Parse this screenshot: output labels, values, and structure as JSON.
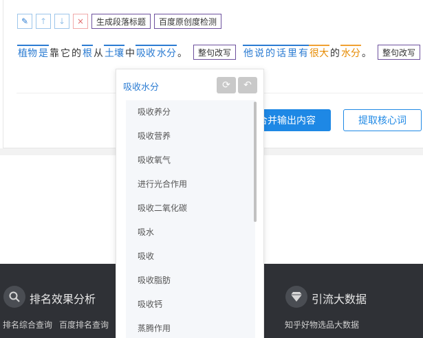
{
  "toolbar": {
    "edit_icon": "✎",
    "up_icon": "↑",
    "down_icon": "↓",
    "close_icon": "×",
    "generate_heading_label": "生成段落标题",
    "originality_check_label": "百度原创度检测"
  },
  "sentence1": {
    "words": [
      "植物",
      "是",
      "靠",
      "它",
      "的",
      "根",
      "从",
      "土壤",
      "中",
      "吸收",
      "水分",
      "。"
    ],
    "rewrite_label": "整句改写"
  },
  "sentence2": {
    "words": [
      "他",
      "说",
      "的",
      "话",
      "里",
      "有",
      "很大",
      "的",
      "水分",
      "。"
    ],
    "rewrite_label": "整句改写"
  },
  "actions": {
    "primary_label": "合并输出内容",
    "extract_label": "提取核心词"
  },
  "dropdown": {
    "title": "吸收水分",
    "refresh_icon": "⟳",
    "undo_icon": "↶",
    "items": [
      "吸收养分",
      "吸收营养",
      "吸收氧气",
      "进行光合作用",
      "吸收二氧化碳",
      "吸水",
      "吸收",
      "吸收脂肪",
      "吸收钙",
      "蒸腾作用"
    ]
  },
  "footer": {
    "ranking_title": "排名效果分析",
    "ranking_links": [
      "排名综合查询",
      "百度排名查询"
    ],
    "traffic_title": "引流大数据",
    "traffic_links": [
      "知乎好物选品大数据"
    ]
  },
  "colors": {
    "accent": "#1e88e5",
    "word_blue": "#2a7bd2",
    "word_orange": "#e68a00",
    "footer_bg": "#2f3136"
  }
}
